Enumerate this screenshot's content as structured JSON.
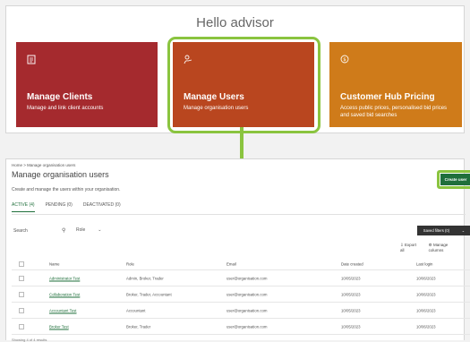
{
  "dashboard": {
    "greeting": "Hello advisor",
    "cards": [
      {
        "icon": "client-list-icon",
        "title": "Manage Clients",
        "description": "Manage and link client accounts",
        "color": "#a52a2e"
      },
      {
        "icon": "user-hand-icon",
        "title": "Manage Users",
        "description": "Manage organisation users",
        "color": "#b9461f"
      },
      {
        "icon": "pricing-coin-icon",
        "title": "Customer Hub Pricing",
        "description": "Access public prices, personalised bid prices and saved bid searches",
        "color": "#cf7b1a"
      }
    ]
  },
  "highlight_color": "#8ac43f",
  "users_page": {
    "breadcrumb": "Home > Manage organisation users",
    "title": "Manage organisation users",
    "subtitle": "Create and manage the users within your organisation.",
    "create_button": "Create user",
    "tabs": [
      {
        "label": "ACTIVE (4)",
        "active": true
      },
      {
        "label": "PENDING (0)",
        "active": false
      },
      {
        "label": "DEACTIVATED (0)",
        "active": false
      }
    ],
    "search_label": "Search",
    "filter_value": "Role",
    "saved_filters": "Saved filters (0)",
    "export_all": "Export all",
    "manage_columns": "Manage columns",
    "columns": [
      "Name",
      "Role",
      "Email",
      "Date created",
      "Last login"
    ],
    "rows": [
      {
        "name": "Administrator Test",
        "role": "Admin, Broker, Trader",
        "email": "user@organisation.com",
        "date": "10/05/2023",
        "login": "10/06/2023"
      },
      {
        "name": "Collaboration Test",
        "role": "Broker, Trader, Accountant",
        "email": "user@organisation.com",
        "date": "10/05/2023",
        "login": "10/06/2023"
      },
      {
        "name": "Accountant Test",
        "role": "Accountant",
        "email": "user@organisation.com",
        "date": "10/05/2023",
        "login": "10/06/2023"
      },
      {
        "name": "Broker Test",
        "role": "Broker, Trader",
        "email": "user@organisation.com",
        "date": "10/05/2023",
        "login": "10/06/2023"
      }
    ],
    "footer": "Showing 4 of 4 results"
  }
}
